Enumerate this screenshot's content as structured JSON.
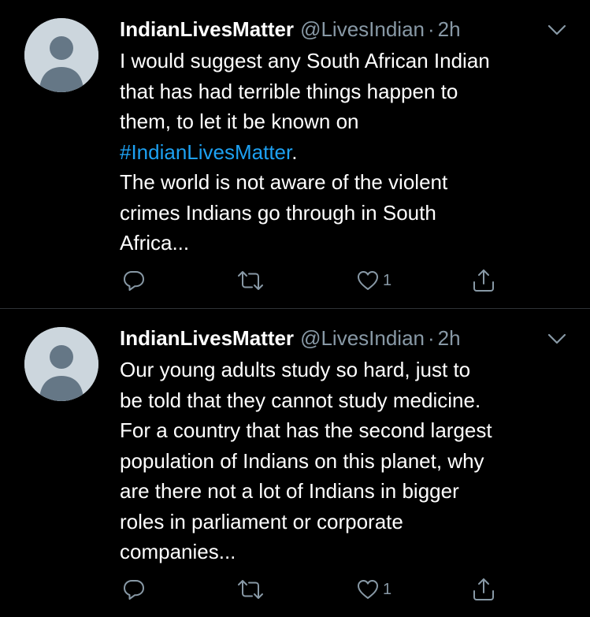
{
  "colors": {
    "background": "#000000",
    "text": "#ffffff",
    "muted": "#8899a6",
    "link": "#1da1f2",
    "divider": "#2f3336",
    "avatar_bg": "#ccd6dd",
    "avatar_fg": "#657786"
  },
  "tweets": [
    {
      "display_name": "IndianLivesMatter",
      "handle": "@LivesIndian",
      "separator": "·",
      "time": "2h",
      "lines": [
        {
          "text": "I would suggest any South African Indian"
        },
        {
          "text": "that has had terrible things happen to"
        },
        {
          "text": "them, to let it be known on"
        },
        {
          "hashtag": "#IndianLivesMatter",
          "suffix": "."
        },
        {
          "text": "The world is not aware of the violent"
        },
        {
          "text": "crimes Indians go through in South"
        },
        {
          "text": "Africa..."
        }
      ],
      "icons": {
        "reply": "reply-icon",
        "retweet": "retweet-icon",
        "like": "heart-icon",
        "share": "share-icon",
        "caret": "chevron-down-icon"
      },
      "like_count": "1"
    },
    {
      "display_name": "IndianLivesMatter",
      "handle": "@LivesIndian",
      "separator": "·",
      "time": "2h",
      "lines": [
        {
          "text": "Our young adults study so hard, just to"
        },
        {
          "text": "be told that they cannot study medicine."
        },
        {
          "text": "For a country that has the second largest"
        },
        {
          "text": "population of Indians on this planet, why"
        },
        {
          "text": "are there not a lot of Indians in bigger"
        },
        {
          "text": "roles in parliament or corporate"
        },
        {
          "text": "companies..."
        }
      ],
      "icons": {
        "reply": "reply-icon",
        "retweet": "retweet-icon",
        "like": "heart-icon",
        "share": "share-icon",
        "caret": "chevron-down-icon"
      },
      "like_count": "1"
    }
  ]
}
